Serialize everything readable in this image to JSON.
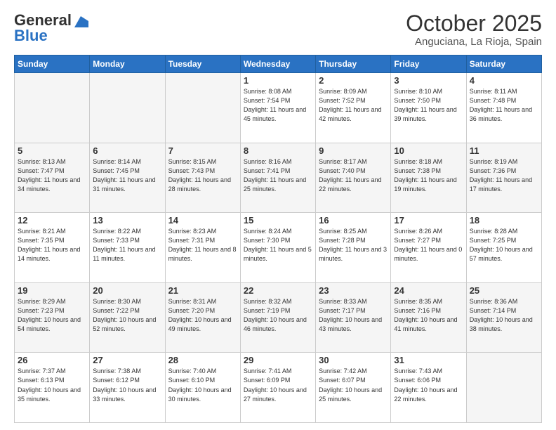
{
  "header": {
    "logo_general": "General",
    "logo_blue": "Blue",
    "month": "October 2025",
    "location": "Anguciana, La Rioja, Spain"
  },
  "days_of_week": [
    "Sunday",
    "Monday",
    "Tuesday",
    "Wednesday",
    "Thursday",
    "Friday",
    "Saturday"
  ],
  "weeks": [
    [
      {
        "day": "",
        "sunrise": "",
        "sunset": "",
        "daylight": ""
      },
      {
        "day": "",
        "sunrise": "",
        "sunset": "",
        "daylight": ""
      },
      {
        "day": "",
        "sunrise": "",
        "sunset": "",
        "daylight": ""
      },
      {
        "day": "1",
        "sunrise": "Sunrise: 8:08 AM",
        "sunset": "Sunset: 7:54 PM",
        "daylight": "Daylight: 11 hours and 45 minutes."
      },
      {
        "day": "2",
        "sunrise": "Sunrise: 8:09 AM",
        "sunset": "Sunset: 7:52 PM",
        "daylight": "Daylight: 11 hours and 42 minutes."
      },
      {
        "day": "3",
        "sunrise": "Sunrise: 8:10 AM",
        "sunset": "Sunset: 7:50 PM",
        "daylight": "Daylight: 11 hours and 39 minutes."
      },
      {
        "day": "4",
        "sunrise": "Sunrise: 8:11 AM",
        "sunset": "Sunset: 7:48 PM",
        "daylight": "Daylight: 11 hours and 36 minutes."
      }
    ],
    [
      {
        "day": "5",
        "sunrise": "Sunrise: 8:13 AM",
        "sunset": "Sunset: 7:47 PM",
        "daylight": "Daylight: 11 hours and 34 minutes."
      },
      {
        "day": "6",
        "sunrise": "Sunrise: 8:14 AM",
        "sunset": "Sunset: 7:45 PM",
        "daylight": "Daylight: 11 hours and 31 minutes."
      },
      {
        "day": "7",
        "sunrise": "Sunrise: 8:15 AM",
        "sunset": "Sunset: 7:43 PM",
        "daylight": "Daylight: 11 hours and 28 minutes."
      },
      {
        "day": "8",
        "sunrise": "Sunrise: 8:16 AM",
        "sunset": "Sunset: 7:41 PM",
        "daylight": "Daylight: 11 hours and 25 minutes."
      },
      {
        "day": "9",
        "sunrise": "Sunrise: 8:17 AM",
        "sunset": "Sunset: 7:40 PM",
        "daylight": "Daylight: 11 hours and 22 minutes."
      },
      {
        "day": "10",
        "sunrise": "Sunrise: 8:18 AM",
        "sunset": "Sunset: 7:38 PM",
        "daylight": "Daylight: 11 hours and 19 minutes."
      },
      {
        "day": "11",
        "sunrise": "Sunrise: 8:19 AM",
        "sunset": "Sunset: 7:36 PM",
        "daylight": "Daylight: 11 hours and 17 minutes."
      }
    ],
    [
      {
        "day": "12",
        "sunrise": "Sunrise: 8:21 AM",
        "sunset": "Sunset: 7:35 PM",
        "daylight": "Daylight: 11 hours and 14 minutes."
      },
      {
        "day": "13",
        "sunrise": "Sunrise: 8:22 AM",
        "sunset": "Sunset: 7:33 PM",
        "daylight": "Daylight: 11 hours and 11 minutes."
      },
      {
        "day": "14",
        "sunrise": "Sunrise: 8:23 AM",
        "sunset": "Sunset: 7:31 PM",
        "daylight": "Daylight: 11 hours and 8 minutes."
      },
      {
        "day": "15",
        "sunrise": "Sunrise: 8:24 AM",
        "sunset": "Sunset: 7:30 PM",
        "daylight": "Daylight: 11 hours and 5 minutes."
      },
      {
        "day": "16",
        "sunrise": "Sunrise: 8:25 AM",
        "sunset": "Sunset: 7:28 PM",
        "daylight": "Daylight: 11 hours and 3 minutes."
      },
      {
        "day": "17",
        "sunrise": "Sunrise: 8:26 AM",
        "sunset": "Sunset: 7:27 PM",
        "daylight": "Daylight: 11 hours and 0 minutes."
      },
      {
        "day": "18",
        "sunrise": "Sunrise: 8:28 AM",
        "sunset": "Sunset: 7:25 PM",
        "daylight": "Daylight: 10 hours and 57 minutes."
      }
    ],
    [
      {
        "day": "19",
        "sunrise": "Sunrise: 8:29 AM",
        "sunset": "Sunset: 7:23 PM",
        "daylight": "Daylight: 10 hours and 54 minutes."
      },
      {
        "day": "20",
        "sunrise": "Sunrise: 8:30 AM",
        "sunset": "Sunset: 7:22 PM",
        "daylight": "Daylight: 10 hours and 52 minutes."
      },
      {
        "day": "21",
        "sunrise": "Sunrise: 8:31 AM",
        "sunset": "Sunset: 7:20 PM",
        "daylight": "Daylight: 10 hours and 49 minutes."
      },
      {
        "day": "22",
        "sunrise": "Sunrise: 8:32 AM",
        "sunset": "Sunset: 7:19 PM",
        "daylight": "Daylight: 10 hours and 46 minutes."
      },
      {
        "day": "23",
        "sunrise": "Sunrise: 8:33 AM",
        "sunset": "Sunset: 7:17 PM",
        "daylight": "Daylight: 10 hours and 43 minutes."
      },
      {
        "day": "24",
        "sunrise": "Sunrise: 8:35 AM",
        "sunset": "Sunset: 7:16 PM",
        "daylight": "Daylight: 10 hours and 41 minutes."
      },
      {
        "day": "25",
        "sunrise": "Sunrise: 8:36 AM",
        "sunset": "Sunset: 7:14 PM",
        "daylight": "Daylight: 10 hours and 38 minutes."
      }
    ],
    [
      {
        "day": "26",
        "sunrise": "Sunrise: 7:37 AM",
        "sunset": "Sunset: 6:13 PM",
        "daylight": "Daylight: 10 hours and 35 minutes."
      },
      {
        "day": "27",
        "sunrise": "Sunrise: 7:38 AM",
        "sunset": "Sunset: 6:12 PM",
        "daylight": "Daylight: 10 hours and 33 minutes."
      },
      {
        "day": "28",
        "sunrise": "Sunrise: 7:40 AM",
        "sunset": "Sunset: 6:10 PM",
        "daylight": "Daylight: 10 hours and 30 minutes."
      },
      {
        "day": "29",
        "sunrise": "Sunrise: 7:41 AM",
        "sunset": "Sunset: 6:09 PM",
        "daylight": "Daylight: 10 hours and 27 minutes."
      },
      {
        "day": "30",
        "sunrise": "Sunrise: 7:42 AM",
        "sunset": "Sunset: 6:07 PM",
        "daylight": "Daylight: 10 hours and 25 minutes."
      },
      {
        "day": "31",
        "sunrise": "Sunrise: 7:43 AM",
        "sunset": "Sunset: 6:06 PM",
        "daylight": "Daylight: 10 hours and 22 minutes."
      },
      {
        "day": "",
        "sunrise": "",
        "sunset": "",
        "daylight": ""
      }
    ]
  ]
}
